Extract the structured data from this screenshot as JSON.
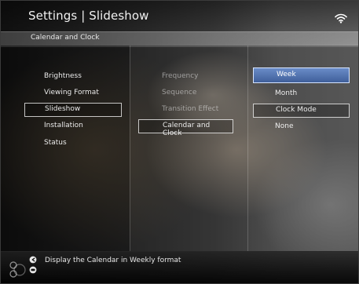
{
  "header": {
    "title": "Settings | Slideshow",
    "section_label": "Calendar and Clock"
  },
  "icons": {
    "wifi": "wifi-icon",
    "back": "back-icon",
    "ok": "ok-icon",
    "nav": "nav-pad-icon"
  },
  "menu": {
    "main_items": [
      "Brightness",
      "Viewing Format",
      "Slideshow",
      "Installation",
      "Status"
    ],
    "slideshow_items": [
      "Frequency",
      "Sequence",
      "Transition Effect",
      "Calendar and Clock"
    ],
    "options": [
      "Week",
      "Month",
      "Clock Mode",
      "None"
    ]
  },
  "hint": {
    "text": "Display the Calendar in Weekly format"
  },
  "colors": {
    "highlight": "#4f6fa9",
    "highlight_border": "#d8e6ff"
  }
}
